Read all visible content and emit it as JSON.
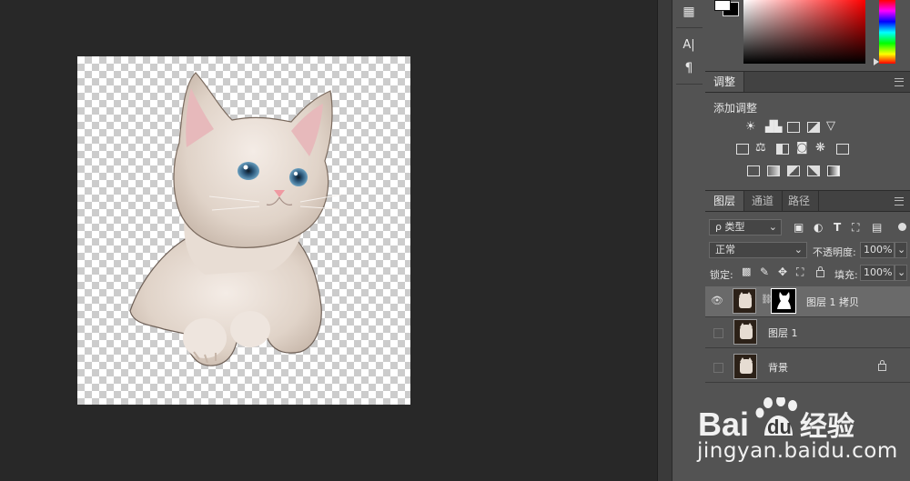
{
  "toolbar": {
    "items": [
      {
        "icon": "properties-icon",
        "glyph": "▦"
      },
      {
        "icon": "character-icon",
        "glyph": "A|"
      },
      {
        "icon": "paragraph-icon",
        "glyph": "¶"
      }
    ]
  },
  "adjustments_panel": {
    "tab_label": "调整",
    "title": "添加调整",
    "rows": [
      [
        "brightness-contrast-icon",
        "levels-icon",
        "curves-icon",
        "exposure-icon",
        "vibrance-icon"
      ],
      [
        "hue-saturation-icon",
        "color-balance-icon",
        "black-white-icon",
        "photo-filter-icon",
        "channel-mixer-icon",
        "color-lookup-icon"
      ],
      [
        "invert-icon",
        "posterize-icon",
        "threshold-icon",
        "selective-color-icon",
        "gradient-map-icon"
      ]
    ]
  },
  "layers_panel": {
    "tabs": [
      {
        "label": "图层",
        "active": true
      },
      {
        "label": "通道",
        "active": false
      },
      {
        "label": "路径",
        "active": false
      }
    ],
    "filter_label": "ρ 类型",
    "blend_mode": "正常",
    "opacity_label": "不透明度:",
    "opacity_value": "100%",
    "lock_label": "锁定:",
    "fill_label": "填充:",
    "fill_value": "100%",
    "layers": [
      {
        "name": "图层 1 拷贝",
        "visible": true,
        "selected": true,
        "has_mask": true,
        "locked": false
      },
      {
        "name": "图层 1",
        "visible": false,
        "selected": false,
        "has_mask": false,
        "locked": false
      },
      {
        "name": "背景",
        "visible": false,
        "selected": false,
        "has_mask": false,
        "locked": true
      }
    ]
  },
  "colors": {
    "foreground": "#ffffff",
    "background": "#000000",
    "canvas_bg": "#282828",
    "panel_bg": "#535353"
  },
  "watermark": {
    "brand_left": "Bai",
    "brand_right": "经验",
    "url": "jingyan.baidu.com"
  }
}
